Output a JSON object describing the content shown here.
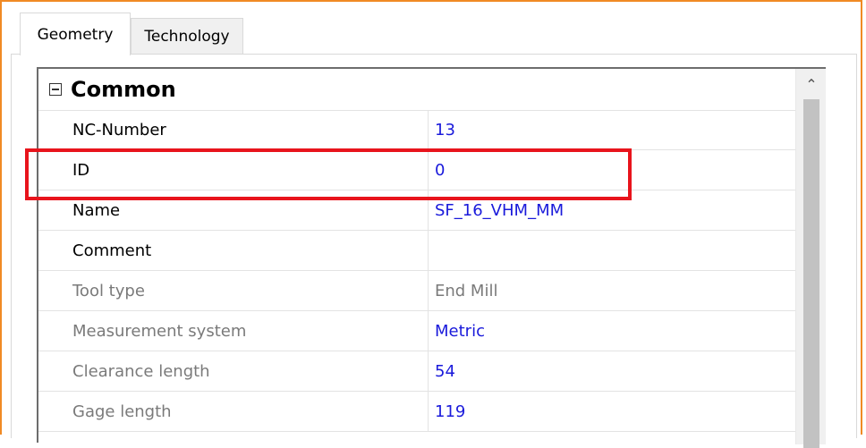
{
  "tabs": [
    {
      "label": "Geometry",
      "active": true
    },
    {
      "label": "Technology",
      "active": false
    }
  ],
  "category": {
    "label": "Common",
    "expanded": true
  },
  "rows": [
    {
      "name": "NC-Number",
      "value": "13"
    },
    {
      "name": "ID",
      "value": "0"
    },
    {
      "name": "Name",
      "value": "SF_16_VHM_MM"
    },
    {
      "name": "Comment",
      "value": ""
    },
    {
      "name": "Tool type",
      "value": "End Mill"
    },
    {
      "name": "Measurement system",
      "value": "Metric"
    },
    {
      "name": "Clearance length",
      "value": "54"
    },
    {
      "name": "Gage length",
      "value": "119"
    }
  ],
  "colors": {
    "frame_accent": "#f08a24",
    "value_text": "#1a1adb",
    "disabled_text": "#7a7a7a",
    "highlight": "#e8141c"
  },
  "icons": {
    "collapse": "minus-square-icon",
    "scroll_up": "chevron-up-icon"
  }
}
